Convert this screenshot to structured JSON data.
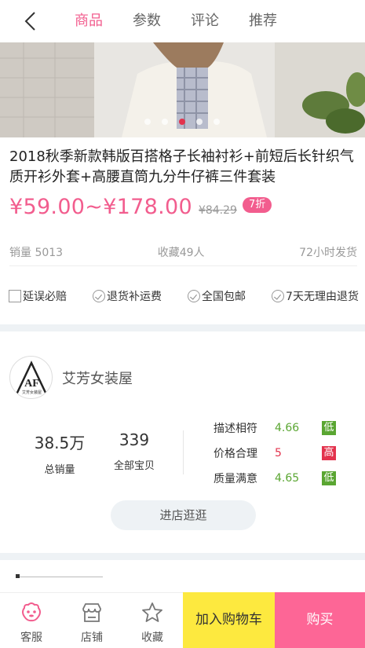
{
  "nav": {
    "tabs": [
      {
        "label": "商品",
        "active": true
      },
      {
        "label": "参数"
      },
      {
        "label": "评论"
      },
      {
        "label": "推荐"
      }
    ]
  },
  "product": {
    "title": "2018秋季新款韩版百搭格子长袖衬衫+前短后长针织气质开衫外套+高腰直筒九分牛仔裤三件套装",
    "price": "¥59.00~¥178.00",
    "original_price": "¥84.29",
    "discount": "7折",
    "sales": "销量 5013",
    "favorites": "收藏49人",
    "shipping": "72小时发货",
    "carousel_total": 5,
    "carousel_active": 3
  },
  "guarantees": [
    "延误必赔",
    "退货补运费",
    "全国包邮",
    "7天无理由退货"
  ],
  "shop": {
    "name": "艾芳女装屋",
    "logo_text": "AF",
    "logo_subtext": "艾芳女装屋",
    "total_sales": {
      "value": "38.5万",
      "label": "总销量"
    },
    "all_items": {
      "value": "339",
      "label": "全部宝贝"
    },
    "ratings": [
      {
        "label": "描述相符",
        "value": "4.66",
        "tag": "低",
        "value_color": "#5aa632",
        "tag_color": "#5aa632"
      },
      {
        "label": "价格合理",
        "value": "5",
        "tag": "高",
        "value_color": "#e3334d",
        "tag_color": "#e3334d"
      },
      {
        "label": "质量满意",
        "value": "4.65",
        "tag": "低",
        "value_color": "#5aa632",
        "tag_color": "#5aa632"
      }
    ],
    "visit_label": "进店逛逛"
  },
  "bottom": {
    "service": "客服",
    "store": "店铺",
    "favorite": "收藏",
    "add_to_cart": "加入购物车",
    "buy": "购买"
  },
  "colors": {
    "accent": "#f25d8e",
    "cart": "#fde93f",
    "buy": "#fd6696"
  }
}
